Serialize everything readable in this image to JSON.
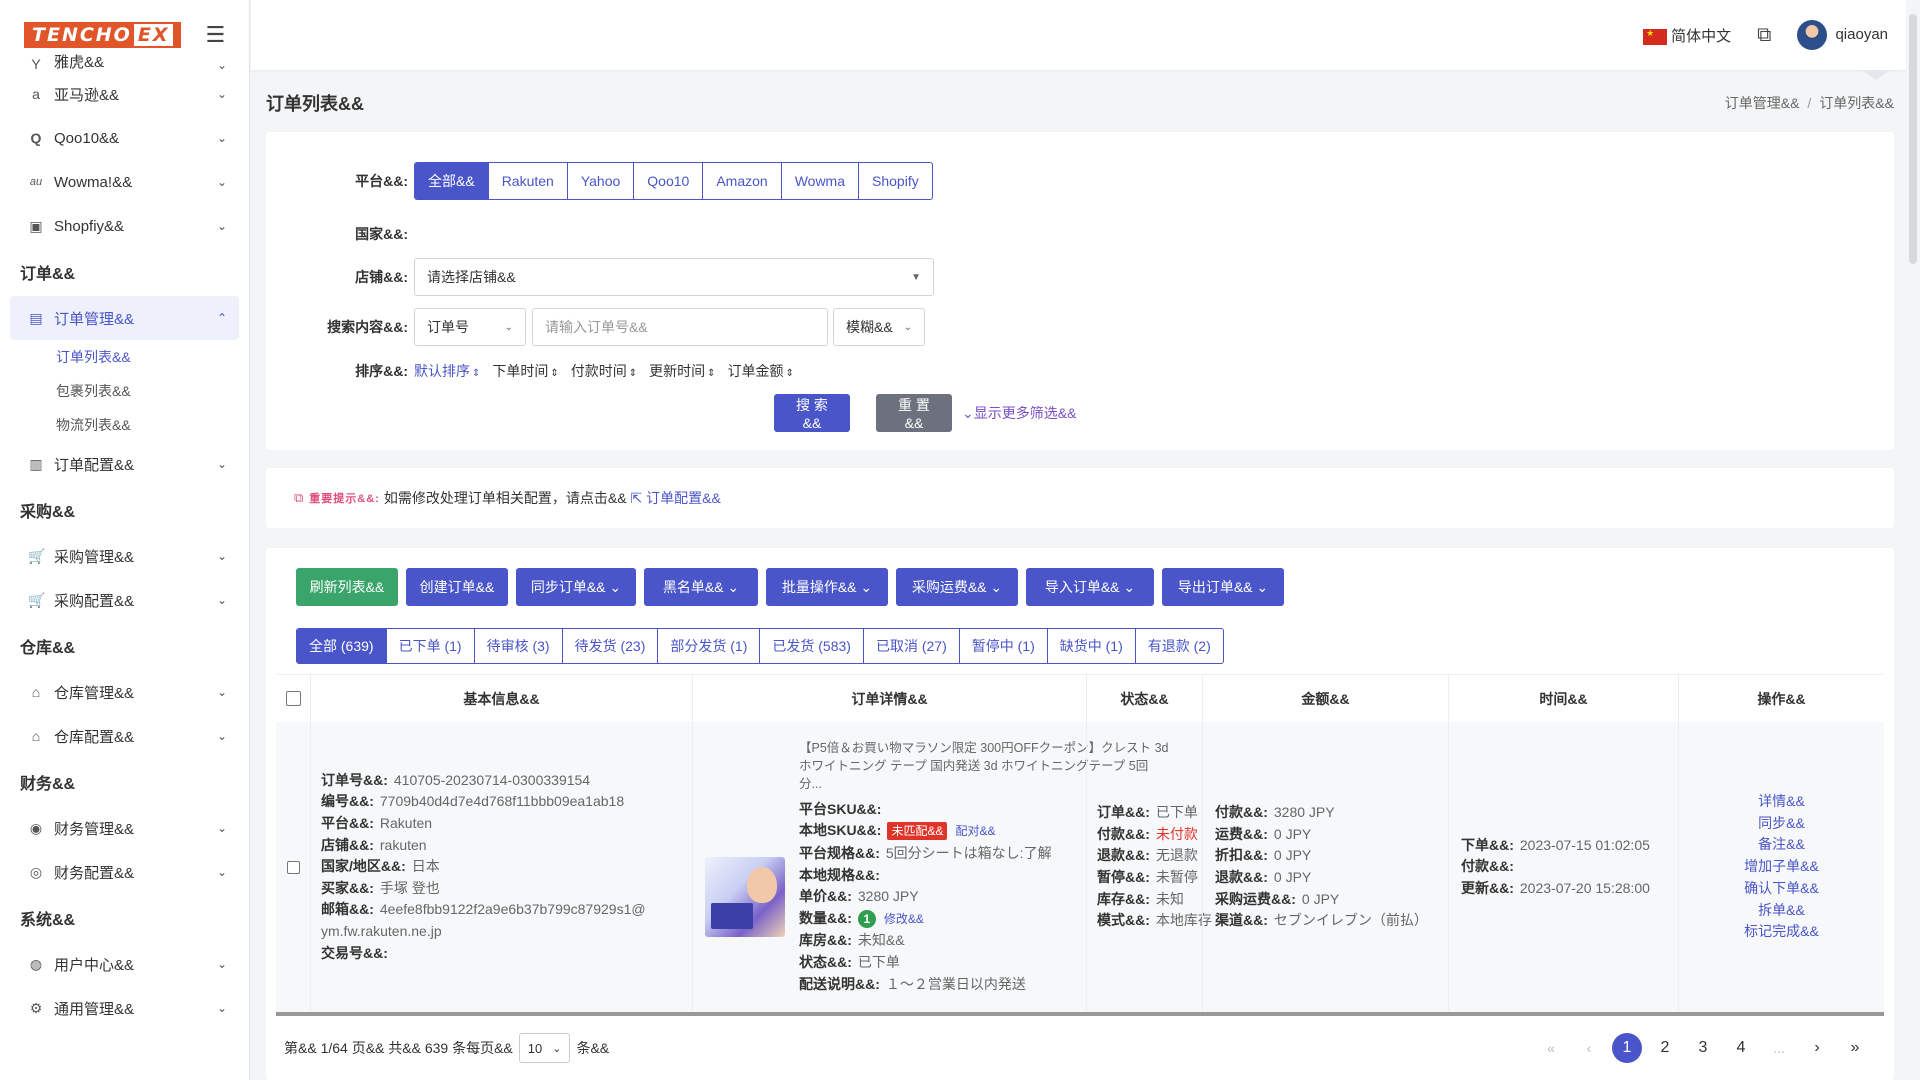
{
  "brand": {
    "logo_part1": "TENCHO",
    "logo_part2": "EX"
  },
  "sidebar": {
    "top_items": [
      {
        "label": "雅虎&&",
        "icon": "y"
      },
      {
        "label": "亚马逊&&",
        "icon": "a"
      },
      {
        "label": "Qoo10&&",
        "icon": "Q"
      },
      {
        "label": "Wowma!&&",
        "icon": "au"
      },
      {
        "label": "Shopfiy&&",
        "icon": "🛍"
      }
    ],
    "groups": {
      "order": "订单&&",
      "purchase": "采购&&",
      "warehouse": "仓库&&",
      "finance": "财务&&",
      "system": "系统&&"
    },
    "order_management": "订单管理&&",
    "order_subs": [
      "订单列表&&",
      "包裹列表&&",
      "物流列表&&"
    ],
    "order_config": "订单配置&&",
    "purchase_items": [
      "采购管理&&",
      "采购配置&&"
    ],
    "warehouse_items": [
      "仓库管理&&",
      "仓库配置&&"
    ],
    "finance_items": [
      "财务管理&&",
      "财务配置&&"
    ],
    "system_items": [
      "用户中心&&",
      "通用管理&&"
    ]
  },
  "header": {
    "language": "简体中文",
    "username": "qiaoyan"
  },
  "page": {
    "title": "订单列表&&",
    "breadcrumb": [
      "订单管理&&",
      "订单列表&&"
    ]
  },
  "filters": {
    "platform_label": "平台&&:",
    "platforms": [
      "全部&&",
      "Rakuten",
      "Yahoo",
      "Qoo10",
      "Amazon",
      "Wowma",
      "Shopify"
    ],
    "country_label": "国家&&:",
    "shop_label": "店铺&&:",
    "shop_placeholder": "请选择店铺&&",
    "search_label": "搜索内容&&:",
    "search_type": "订单号",
    "search_placeholder": "请输入订单号&&",
    "match_mode": "模糊&&",
    "sort_label": "排序&&:",
    "sorts": [
      "默认排序",
      "下单时间",
      "付款时间",
      "更新时间",
      "订单金额"
    ],
    "search_btn": "搜 索&&",
    "reset_btn": "重 置&&",
    "more_filters": "显示更多筛选&&"
  },
  "notice": {
    "key": "重要提示&&:",
    "text": "如需修改处理订单相关配置，请点击&&",
    "link": "订单配置&&"
  },
  "toolbar": {
    "refresh": "刷新列表&&",
    "create": "创建订单&&",
    "sync": "同步订单&&",
    "blacklist": "黑名单&&",
    "batch": "批量操作&&",
    "purchase_freight": "采购运费&&",
    "import": "导入订单&&",
    "export": "导出订单&&"
  },
  "status_tabs": [
    "全部 (639)",
    "已下单 (1)",
    "待审核 (3)",
    "待发货 (23)",
    "部分发货 (1)",
    "已发货 (583)",
    "已取消 (27)",
    "暂停中 (1)",
    "缺货中 (1)",
    "有退款 (2)"
  ],
  "table": {
    "headers": [
      "基本信息&&",
      "订单详情&&",
      "状态&&",
      "金额&&",
      "时间&&",
      "操作&&"
    ],
    "row": {
      "basic": [
        {
          "k": "订单号&&:",
          "v": "410705-20230714-0300339154"
        },
        {
          "k": "编号&&:",
          "v": "7709b40d4d7e4d768f11bbb09ea1ab18"
        },
        {
          "k": "平台&&:",
          "v": "Rakuten"
        },
        {
          "k": "店铺&&:",
          "v": "rakuten"
        },
        {
          "k": "国家/地区&&:",
          "v": "日本"
        },
        {
          "k": "买家&&:",
          "v": "手塚 登也"
        },
        {
          "k": "邮箱&&:",
          "v": "4eefe8fbb9122f2a9e6b37b799c87929s1@"
        },
        {
          "k": "",
          "v": "ym.fw.rakuten.ne.jp"
        },
        {
          "k": "交易号&&:",
          "v": ""
        }
      ],
      "product_title": "【P5倍＆お買い物マラソン限定 300円OFFクーポン】クレスト 3d ホワイトニング テープ 国内発送 3d ホワイトニングテープ 5回分...",
      "detail": {
        "platform_sku_k": "平台SKU&&:",
        "local_sku_k": "本地SKU&&:",
        "unmatched_tag": "未匹配&&",
        "match_link": "配对&&",
        "spec_k": "平台规格&&:",
        "spec_v": "5回分シートは箱なし:了解",
        "local_spec_k": "本地规格&&:",
        "price_k": "单价&&:",
        "price_v": "3280  JPY",
        "qty_k": "数量&&:",
        "qty_v": "1",
        "qty_edit": "修改&&",
        "store_k": "库房&&:",
        "store_v": "未知&&",
        "state_k": "状态&&:",
        "state_v": "已下单",
        "ship_k": "配送说明&&:",
        "ship_v": "１～２営業日以内発送"
      },
      "status": [
        {
          "k": "订单&&:",
          "v": "已下单",
          "red": false
        },
        {
          "k": "付款&&:",
          "v": "未付款",
          "red": true
        },
        {
          "k": "退款&&:",
          "v": "无退款",
          "red": false
        },
        {
          "k": "暂停&&:",
          "v": "未暂停",
          "red": false
        },
        {
          "k": "库存&&:",
          "v": "未知",
          "red": false
        },
        {
          "k": "模式&&:",
          "v": "本地库存",
          "red": false
        }
      ],
      "amount": [
        {
          "k": "付款&&:",
          "v": "3280 JPY"
        },
        {
          "k": "运费&&:",
          "v": "0 JPY"
        },
        {
          "k": "折扣&&:",
          "v": "0 JPY"
        },
        {
          "k": "退款&&:",
          "v": "0 JPY"
        },
        {
          "k": "采购运费&&:",
          "v": "0 JPY"
        },
        {
          "k": "渠道&&:",
          "v": "セブンイレブン（前払）"
        }
      ],
      "time": [
        {
          "k": "下单&&:",
          "v": "2023-07-15 01:02:05"
        },
        {
          "k": "付款&&:",
          "v": ""
        },
        {
          "k": "更新&&:",
          "v": "2023-07-20 15:28:00"
        }
      ],
      "ops": [
        "详情&&",
        "同步&&",
        "备注&&",
        "增加子单&&",
        "确认下单&&",
        "拆单&&",
        "标记完成&&"
      ]
    }
  },
  "pager": {
    "summary": "第&& 1/64 页&& 共&& 639 条每页&&",
    "page_size": "10",
    "unit": "条&&",
    "first": "«",
    "prev": "‹",
    "pages": [
      "1",
      "2",
      "3",
      "4"
    ],
    "ellipsis": "...",
    "next": "›",
    "last": "»"
  }
}
